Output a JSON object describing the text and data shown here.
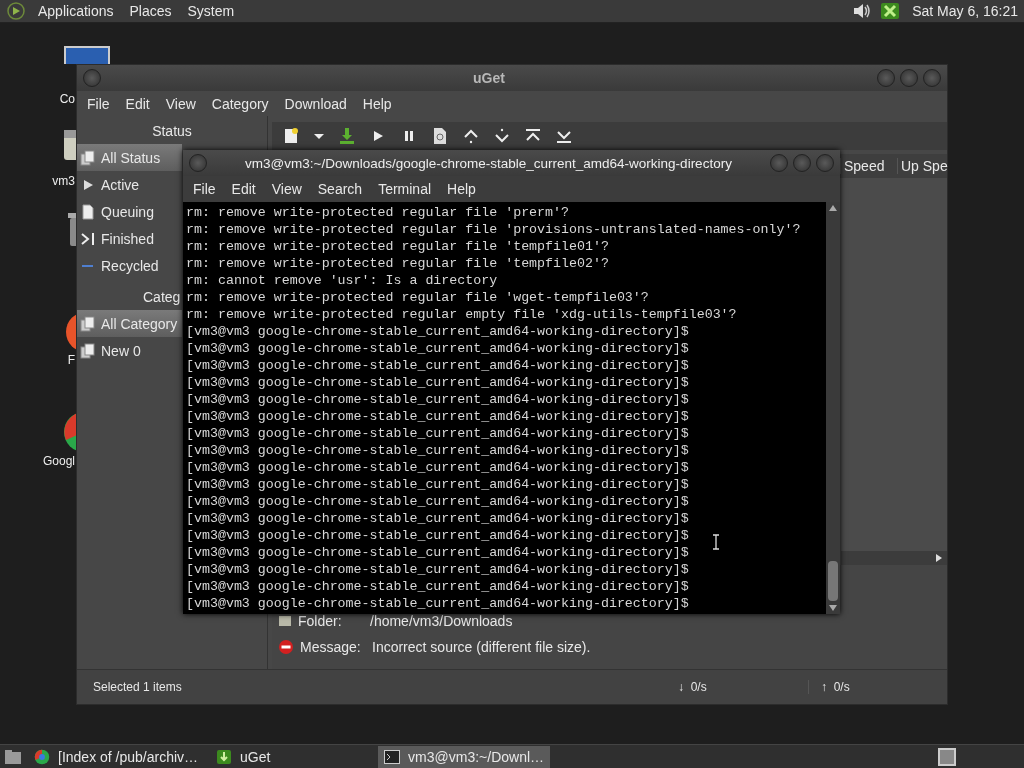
{
  "top_panel": {
    "menus": [
      "Applications",
      "Places",
      "System"
    ],
    "clock": "Sat May  6, 16:21"
  },
  "desktop_icons": [
    {
      "kind": "computer",
      "label": "Co"
    },
    {
      "kind": "drive",
      "label": "vm3"
    },
    {
      "kind": "trash"
    },
    {
      "kind": "firefox",
      "label": "F"
    },
    {
      "kind": "chrome",
      "label": "Googl"
    }
  ],
  "uget": {
    "title": "uGet",
    "menu": [
      "File",
      "Edit",
      "View",
      "Category",
      "Download",
      "Help"
    ],
    "status_header": "Status",
    "status_items": [
      {
        "kind": "all",
        "label": "All Status",
        "selected": true
      },
      {
        "kind": "active",
        "label": "Active",
        "selected": false
      },
      {
        "kind": "queuing",
        "label": "Queuing",
        "selected": false
      },
      {
        "kind": "finished",
        "label": "Finished",
        "selected": false
      },
      {
        "kind": "recycled",
        "label": "Recycled",
        "selected": false
      }
    ],
    "category_header": "Categ",
    "category_items": [
      {
        "label": "All Category",
        "selected": true
      },
      {
        "label": "New 0",
        "selected": false
      }
    ],
    "columns": [
      "Speed",
      "Up Spe"
    ],
    "details": [
      {
        "kind": "folder",
        "label": "Folder:",
        "value": "/home/vm3/Downloads"
      },
      {
        "kind": "error",
        "label": "Message:",
        "value": "Incorrect source (different file size)."
      }
    ],
    "status_bar": {
      "selected": "Selected 1 items",
      "down": "0/s",
      "up": "0/s",
      "down_arrow": "↓",
      "up_arrow": "↑"
    }
  },
  "terminal": {
    "title": "vm3@vm3:~/Downloads/google-chrome-stable_current_amd64-working-directory",
    "menu": [
      "File",
      "Edit",
      "View",
      "Search",
      "Terminal",
      "Help"
    ],
    "lines": [
      "rm: remove write-protected regular file 'prerm'?",
      "rm: remove write-protected regular file 'provisions-untranslated-names-only'?",
      "rm: remove write-protected regular file 'tempfile01'?",
      "rm: remove write-protected regular file 'tempfile02'?",
      "rm: cannot remove 'usr': Is a directory",
      "rm: remove write-protected regular file 'wget-tempfile03'?",
      "rm: remove write-protected regular empty file 'xdg-utils-tempfile03'?",
      "[vm3@vm3 google-chrome-stable_current_amd64-working-directory]$",
      "[vm3@vm3 google-chrome-stable_current_amd64-working-directory]$",
      "[vm3@vm3 google-chrome-stable_current_amd64-working-directory]$",
      "[vm3@vm3 google-chrome-stable_current_amd64-working-directory]$",
      "[vm3@vm3 google-chrome-stable_current_amd64-working-directory]$",
      "[vm3@vm3 google-chrome-stable_current_amd64-working-directory]$",
      "[vm3@vm3 google-chrome-stable_current_amd64-working-directory]$",
      "[vm3@vm3 google-chrome-stable_current_amd64-working-directory]$",
      "[vm3@vm3 google-chrome-stable_current_amd64-working-directory]$",
      "[vm3@vm3 google-chrome-stable_current_amd64-working-directory]$",
      "[vm3@vm3 google-chrome-stable_current_amd64-working-directory]$",
      "[vm3@vm3 google-chrome-stable_current_amd64-working-directory]$",
      "[vm3@vm3 google-chrome-stable_current_amd64-working-directory]$",
      "[vm3@vm3 google-chrome-stable_current_amd64-working-directory]$",
      "[vm3@vm3 google-chrome-stable_current_amd64-working-directory]$",
      "[vm3@vm3 google-chrome-stable_current_amd64-working-directory]$",
      "[vm3@vm3 google-chrome-stable_current_amd64-working-directory]$"
    ]
  },
  "taskbar": [
    {
      "kind": "chrome",
      "label": "[Index of /pub/archiv…",
      "selected": false
    },
    {
      "kind": "uget",
      "label": "uGet",
      "selected": false
    },
    {
      "kind": "terminal",
      "label": "vm3@vm3:~/Downl…",
      "selected": true
    }
  ]
}
